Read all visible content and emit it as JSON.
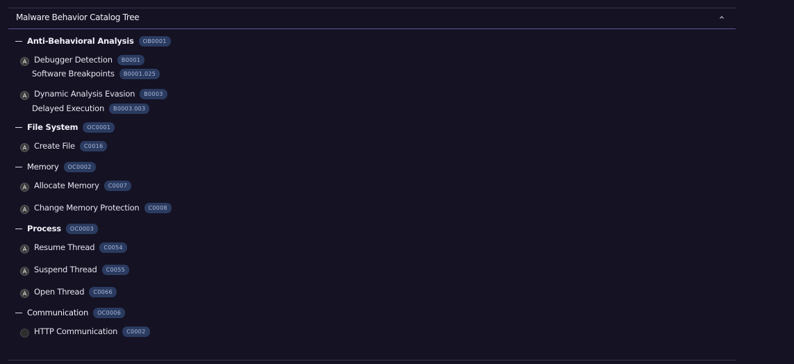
{
  "panel": {
    "title": "Malware Behavior Catalog Tree"
  },
  "tree": {
    "t1": {
      "label": "Anti-Behavioral Analysis",
      "id": "OB0001"
    },
    "b1": {
      "label": "Debugger Detection",
      "id": "B0001"
    },
    "m1": {
      "label": "Software Breakpoints",
      "id": "B0001.025"
    },
    "b2": {
      "label": "Dynamic Analysis Evasion",
      "id": "B0003"
    },
    "m2": {
      "label": "Delayed Execution",
      "id": "B0003.003"
    },
    "t2": {
      "label": "File System",
      "id": "OC0001"
    },
    "b3": {
      "label": "Create File",
      "id": "C0016"
    },
    "t3": {
      "label": "Memory",
      "id": "OC0002"
    },
    "b4": {
      "label": "Allocate Memory",
      "id": "C0007"
    },
    "b5": {
      "label": "Change Memory Protection",
      "id": "C0008"
    },
    "t4": {
      "label": "Process",
      "id": "OC0003"
    },
    "b6": {
      "label": "Resume Thread",
      "id": "C0054"
    },
    "b7": {
      "label": "Suspend Thread",
      "id": "C0055"
    },
    "b8": {
      "label": "Open Thread",
      "id": "C0066"
    },
    "t5": {
      "label": "Communication",
      "id": "OC0006"
    },
    "b9": {
      "label": "HTTP Communication",
      "id": "C0002"
    }
  },
  "icons": {
    "collapse": "chevron-up-icon",
    "tactic": "collapse-dash-icon",
    "behavior": "attack-icon",
    "behavior_empty": "empty-circle-icon"
  }
}
